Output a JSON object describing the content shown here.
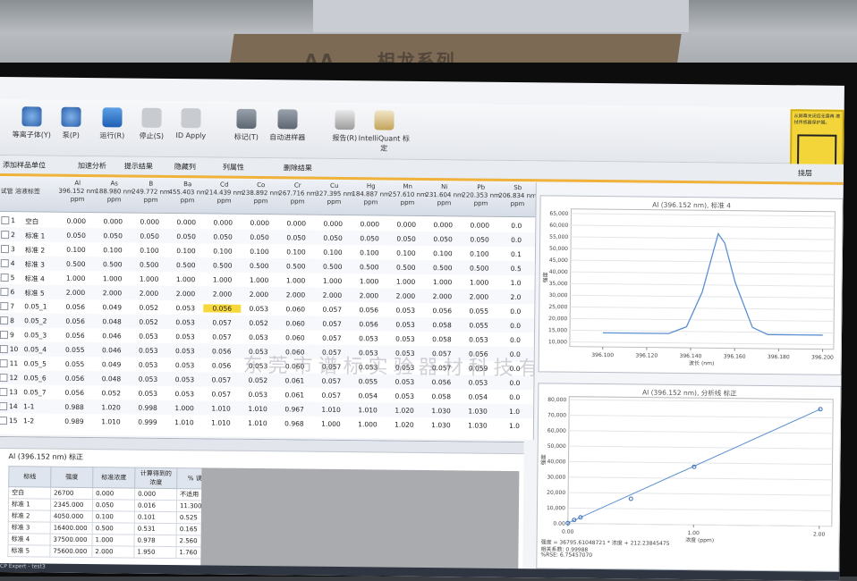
{
  "background": {
    "box_text": "AA ... 相龙系列"
  },
  "toolbar": {
    "buttons": [
      {
        "label": "等离子体(Y)",
        "icon": "plasma-icon"
      },
      {
        "label": "泵(P)",
        "icon": "pump-icon"
      },
      {
        "label": "运行(R)",
        "icon": "run-icon"
      },
      {
        "label": "停止(S)",
        "icon": "stop-icon"
      },
      {
        "label": "ID Apply",
        "icon": "apply-icon"
      },
      {
        "label": "标记(T)",
        "icon": "mark-icon"
      },
      {
        "label": "自动进样器",
        "icon": "autosampler-icon"
      },
      {
        "label": "报告(R)",
        "icon": "report-icon"
      },
      {
        "label": "IntelliQuant 标定",
        "icon": "intelliquant-icon"
      }
    ],
    "warning_text": "从屏幕关闭后无需再 擦拭传感器保护膜。"
  },
  "subbar": {
    "items": [
      "添加样品单位",
      "加速分析",
      "提示结果",
      "隐藏列",
      "列属性",
      "删除结果"
    ],
    "right_label": "挠层"
  },
  "grid": {
    "columns": [
      {
        "el": "Al",
        "wl": "396.152 nm",
        "unit": "ppm"
      },
      {
        "el": "As",
        "wl": "188.980 nm",
        "unit": "ppm"
      },
      {
        "el": "B",
        "wl": "249.772 nm",
        "unit": "ppm"
      },
      {
        "el": "Ba",
        "wl": "455.403 nm",
        "unit": "ppm"
      },
      {
        "el": "Cd",
        "wl": "214.439 nm",
        "unit": "ppm"
      },
      {
        "el": "Co",
        "wl": "238.892 nm",
        "unit": "ppm"
      },
      {
        "el": "Cr",
        "wl": "267.716 nm",
        "unit": "ppm"
      },
      {
        "el": "Cu",
        "wl": "327.395 nm",
        "unit": "ppm"
      },
      {
        "el": "Hg",
        "wl": "184.887 nm",
        "unit": "ppm"
      },
      {
        "el": "Mn",
        "wl": "257.610 nm",
        "unit": "ppm"
      },
      {
        "el": "Ni",
        "wl": "231.604 nm",
        "unit": "ppm"
      },
      {
        "el": "Pb",
        "wl": "220.353 nm",
        "unit": "ppm"
      },
      {
        "el": "Sb",
        "wl": "206.834 nm",
        "unit": "ppm"
      }
    ],
    "head_left": "试管  溶液标签",
    "rows": [
      {
        "n": "1",
        "label": "空白",
        "v": [
          "0.000",
          "0.000",
          "0.000",
          "0.000",
          "0.000",
          "0.000",
          "0.000",
          "0.000",
          "0.000",
          "0.000",
          "0.000",
          "0.000",
          "0.0"
        ]
      },
      {
        "n": "2",
        "label": "标准 1",
        "v": [
          "0.050",
          "0.050",
          "0.050",
          "0.050",
          "0.050",
          "0.050",
          "0.050",
          "0.050",
          "0.050",
          "0.050",
          "0.050",
          "0.050",
          "0.0"
        ]
      },
      {
        "n": "3",
        "label": "标准 2",
        "v": [
          "0.100",
          "0.100",
          "0.100",
          "0.100",
          "0.100",
          "0.100",
          "0.100",
          "0.100",
          "0.100",
          "0.100",
          "0.100",
          "0.100",
          "0.1"
        ]
      },
      {
        "n": "4",
        "label": "标准 3",
        "v": [
          "0.500",
          "0.500",
          "0.500",
          "0.500",
          "0.500",
          "0.500",
          "0.500",
          "0.500",
          "0.500",
          "0.500",
          "0.500",
          "0.500",
          "0.5"
        ]
      },
      {
        "n": "5",
        "label": "标准 4",
        "v": [
          "1.000",
          "1.000",
          "1.000",
          "1.000",
          "1.000",
          "1.000",
          "1.000",
          "1.000",
          "1.000",
          "1.000",
          "1.000",
          "1.000",
          "1.0"
        ]
      },
      {
        "n": "6",
        "label": "标准 5",
        "v": [
          "2.000",
          "2.000",
          "2.000",
          "2.000",
          "2.000",
          "2.000",
          "2.000",
          "2.000",
          "2.000",
          "2.000",
          "2.000",
          "2.000",
          "2.0"
        ]
      },
      {
        "n": "7",
        "label": "0.05_1",
        "v": [
          "0.056",
          "0.049",
          "0.052",
          "0.053",
          "0.056",
          "0.053",
          "0.060",
          "0.057",
          "0.056",
          "0.053",
          "0.056",
          "0.055",
          "0.0"
        ]
      },
      {
        "n": "8",
        "label": "0.05_2",
        "v": [
          "0.056",
          "0.048",
          "0.052",
          "0.053",
          "0.057",
          "0.052",
          "0.060",
          "0.057",
          "0.056",
          "0.053",
          "0.058",
          "0.055",
          "0.0"
        ]
      },
      {
        "n": "9",
        "label": "0.05_3",
        "v": [
          "0.056",
          "0.046",
          "0.053",
          "0.053",
          "0.057",
          "0.053",
          "0.060",
          "0.057",
          "0.053",
          "0.053",
          "0.058",
          "0.053",
          "0.0"
        ]
      },
      {
        "n": "10",
        "label": "0.05_4",
        "v": [
          "0.055",
          "0.046",
          "0.053",
          "0.053",
          "0.056",
          "0.053",
          "0.060",
          "0.057",
          "0.053",
          "0.053",
          "0.057",
          "0.056",
          "0.0"
        ]
      },
      {
        "n": "11",
        "label": "0.05_5",
        "v": [
          "0.055",
          "0.049",
          "0.053",
          "0.053",
          "0.056",
          "0.053",
          "0.060",
          "0.057",
          "0.053",
          "0.053",
          "0.057",
          "0.059",
          "0.0"
        ]
      },
      {
        "n": "12",
        "label": "0.05_6",
        "v": [
          "0.056",
          "0.048",
          "0.053",
          "0.053",
          "0.057",
          "0.052",
          "0.061",
          "0.057",
          "0.055",
          "0.053",
          "0.056",
          "0.053",
          "0.0"
        ]
      },
      {
        "n": "13",
        "label": "0.05_7",
        "v": [
          "0.056",
          "0.052",
          "0.053",
          "0.053",
          "0.057",
          "0.053",
          "0.061",
          "0.057",
          "0.054",
          "0.053",
          "0.058",
          "0.054",
          "0.0"
        ]
      },
      {
        "n": "14",
        "label": "1-1",
        "v": [
          "0.988",
          "1.020",
          "0.998",
          "1.000",
          "1.010",
          "1.010",
          "0.967",
          "1.010",
          "1.010",
          "1.020",
          "1.030",
          "1.030",
          "1.0"
        ]
      },
      {
        "n": "15",
        "label": "1-2",
        "v": [
          "0.989",
          "1.010",
          "0.999",
          "1.010",
          "1.010",
          "1.010",
          "0.968",
          "1.000",
          "1.000",
          "1.020",
          "1.030",
          "1.030",
          "1.0"
        ]
      }
    ],
    "highlight": {
      "row": 6,
      "col": 4
    },
    "watermark": "东莞市谱标实验器材科技有限公司"
  },
  "cal": {
    "title": "Al (396.152 nm) 标正",
    "headers": [
      "标线",
      "强度",
      "标准浓度",
      "计算得到的浓度",
      "% 误差"
    ],
    "rows": [
      [
        "空白",
        "26700",
        "0.000",
        "0.000",
        "不适用"
      ],
      [
        "标准 1",
        "2345.000",
        "0.050",
        "0.016",
        "11.300"
      ],
      [
        "标准 2",
        "4050.000",
        "0.100",
        "0.101",
        "0.525"
      ],
      [
        "标准 3",
        "16400.000",
        "0.500",
        "0.531",
        "0.165"
      ],
      [
        "标准 4",
        "37500.000",
        "1.000",
        "0.978",
        "2.560"
      ],
      [
        "标准 5",
        "75600.000",
        "2.000",
        "1.950",
        "1.760"
      ]
    ],
    "status": "ICP Expert - test3"
  },
  "charts": {
    "spectrum": {
      "title": "Al (396.152 nm), 标准 4",
      "xlabel": "波长 (nm)",
      "ylabel": "强度",
      "xticks": [
        "396.100",
        "396.120",
        "396.140",
        "396.160",
        "396.180",
        "396.200"
      ],
      "yticks": [
        "10,000",
        "15,000",
        "20,000",
        "25,000",
        "30,000",
        "35,000",
        "40,000",
        "45,000",
        "50,000",
        "55,000",
        "60,000",
        "65,000"
      ]
    },
    "calibration": {
      "title": "Al (396.152 nm), 分析线 标正",
      "xlabel": "浓度 (ppm)",
      "ylabel": "强度",
      "xticks": [
        "0.00",
        "1.00",
        "2.00"
      ],
      "yticks": [
        "0.00",
        "10,000",
        "20,000",
        "30,000",
        "40,000",
        "50,000",
        "60,000",
        "70,000",
        "80,000"
      ],
      "equation": "强度 = 36795.61048721 * 浓度 + 212.23845475",
      "corr": "相关系数: 0.99988",
      "formula_line": "%RSE: 6.75457070"
    }
  },
  "chart_data": [
    {
      "type": "line",
      "title": "Al (396.152 nm), 标准 4",
      "xlabel": "波长 (nm)",
      "ylabel": "强度",
      "x": [
        396.1,
        396.11,
        396.12,
        396.13,
        396.138,
        396.145,
        396.15,
        396.152,
        396.155,
        396.16,
        396.168,
        396.175,
        396.185,
        396.2
      ],
      "series": [
        {
          "values": [
            14000,
            14000,
            14000,
            14000,
            17000,
            32000,
            50000,
            57000,
            53000,
            36000,
            17000,
            14000,
            14000,
            14000
          ]
        }
      ],
      "xlim": [
        396.085,
        396.205
      ],
      "ylim": [
        8000,
        67000
      ]
    },
    {
      "type": "scatter",
      "title": "Al (396.152 nm), 分析线 标正",
      "xlabel": "浓度 (ppm)",
      "ylabel": "强度",
      "x": [
        0.0,
        0.05,
        0.1,
        0.5,
        1.0,
        2.0
      ],
      "series": [
        {
          "values": [
            267,
            2345,
            4050,
            16400,
            37500,
            75600
          ]
        }
      ],
      "xlim": [
        0,
        2.1
      ],
      "ylim": [
        0,
        82000
      ]
    }
  ]
}
